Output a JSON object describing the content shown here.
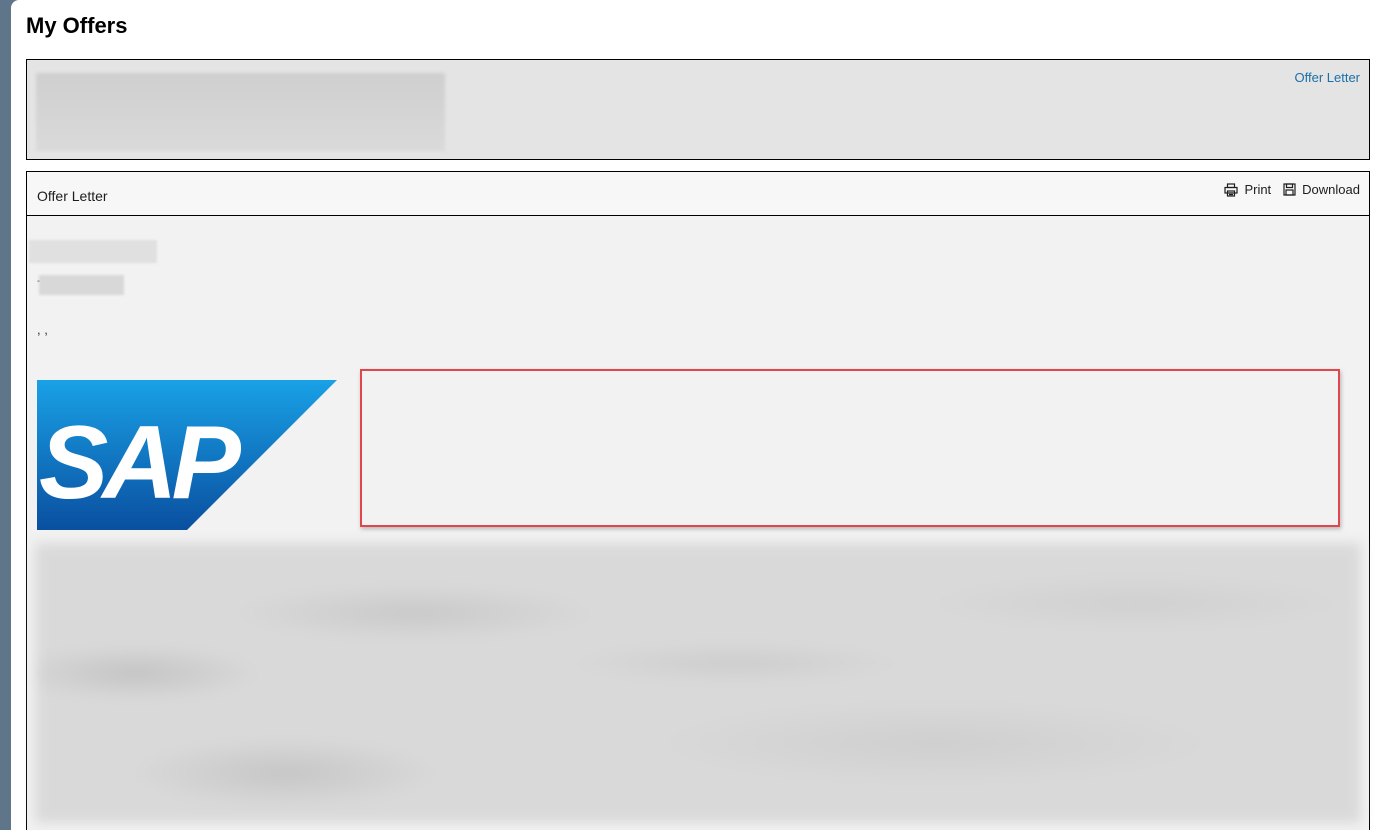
{
  "page": {
    "title": "My Offers"
  },
  "summary": {
    "link_label": "Offer Letter"
  },
  "letter": {
    "title": "Offer Letter",
    "actions": {
      "print_label": "Print",
      "download_label": "Download"
    },
    "dash_text": "-",
    "commas_text": ", ,",
    "logo_text": "SAP"
  },
  "colors": {
    "link": "#1b6fa8",
    "highlight_border": "#e0474c",
    "sap_blue_light": "#19a1e6",
    "sap_blue_dark": "#0a4fa0"
  },
  "icons": {
    "print": "print-icon",
    "download": "save-icon"
  }
}
